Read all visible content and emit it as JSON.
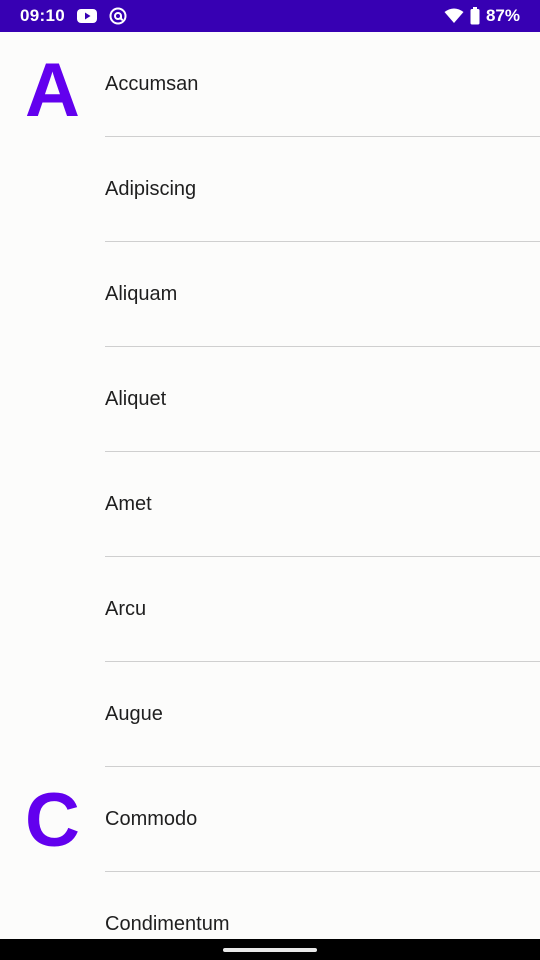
{
  "status_bar": {
    "time": "09:10",
    "battery": "87%",
    "icons": [
      "youtube-icon",
      "at-sign-icon",
      "wifi-icon",
      "battery-icon"
    ],
    "background": "#3700b3"
  },
  "list": {
    "accent_color": "#6200ee",
    "sections": [
      {
        "letter": "A",
        "items": [
          "Accumsan",
          "Adipiscing",
          "Aliquam",
          "Aliquet",
          "Amet",
          "Arcu",
          "Augue"
        ]
      },
      {
        "letter": "C",
        "items": [
          "Commodo",
          "Condimentum"
        ]
      }
    ]
  }
}
